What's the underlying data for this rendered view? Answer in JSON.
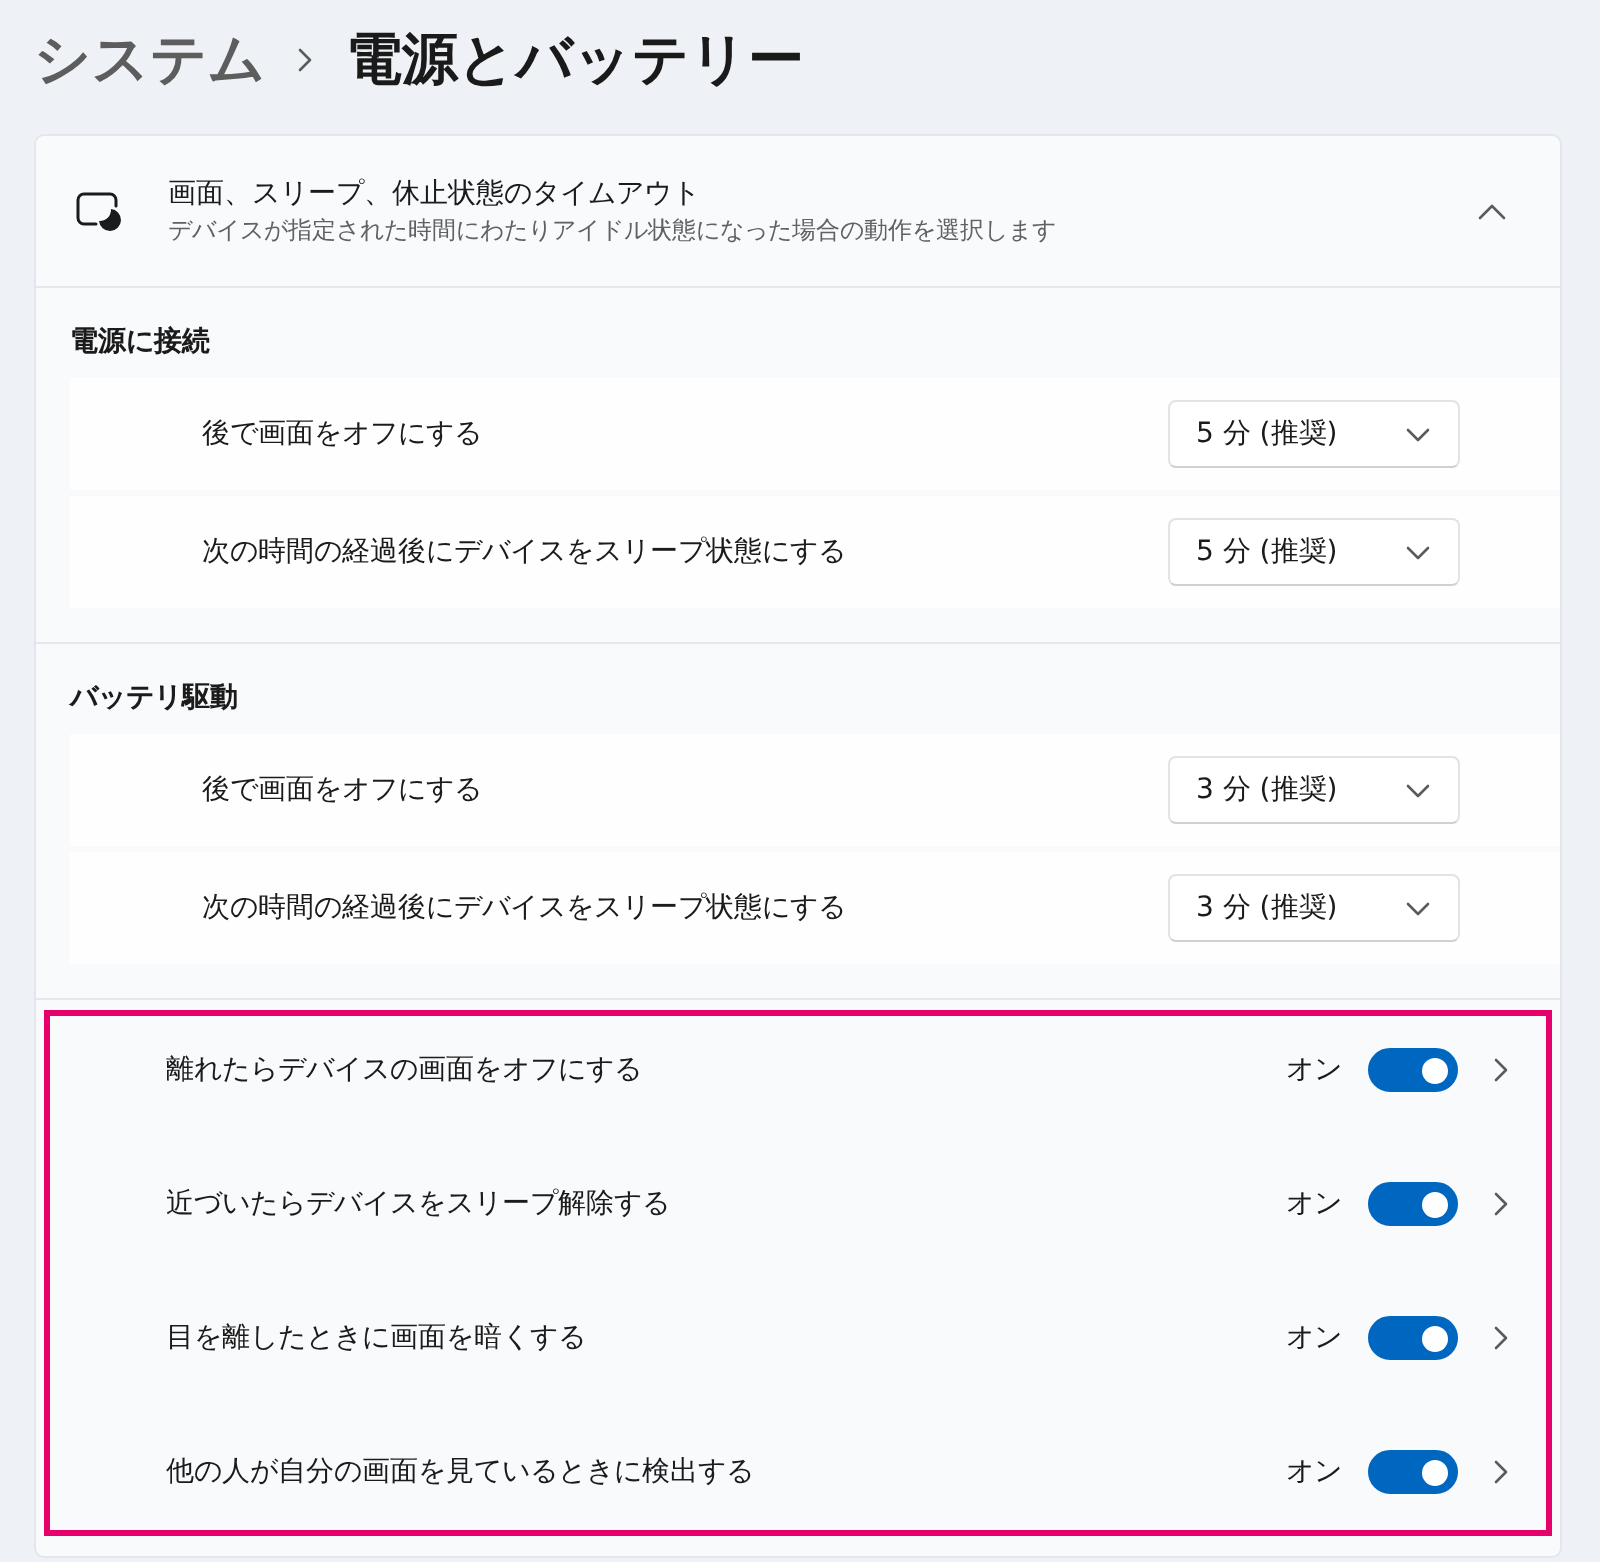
{
  "breadcrumb": {
    "parent": "システム",
    "current": "電源とバッテリー"
  },
  "card": {
    "title": "画面、スリープ、休止状態のタイムアウト",
    "subtitle": "デバイスが指定された時間にわたりアイドル状態になった場合の動作を選択します",
    "expanded": true,
    "groups": [
      {
        "heading": "電源に接続",
        "rows": [
          {
            "label": "後で画面をオフにする",
            "value": "5 分 (推奨)"
          },
          {
            "label": "次の時間の経過後にデバイスをスリープ状態にする",
            "value": "5 分 (推奨)"
          }
        ]
      },
      {
        "heading": "バッテリ駆動",
        "rows": [
          {
            "label": "後で画面をオフにする",
            "value": "3 分 (推奨)"
          },
          {
            "label": "次の時間の経過後にデバイスをスリープ状態にする",
            "value": "3 分 (推奨)"
          }
        ]
      }
    ]
  },
  "toggles": {
    "highlighted": true,
    "items": [
      {
        "label": "離れたらデバイスの画面をオフにする",
        "state_text": "オン",
        "on": true
      },
      {
        "label": "近づいたらデバイスをスリープ解除する",
        "state_text": "オン",
        "on": true
      },
      {
        "label": "目を離したときに画面を暗くする",
        "state_text": "オン",
        "on": true
      },
      {
        "label": "他の人が自分の画面を見ているときに検出する",
        "state_text": "オン",
        "on": true
      }
    ]
  }
}
